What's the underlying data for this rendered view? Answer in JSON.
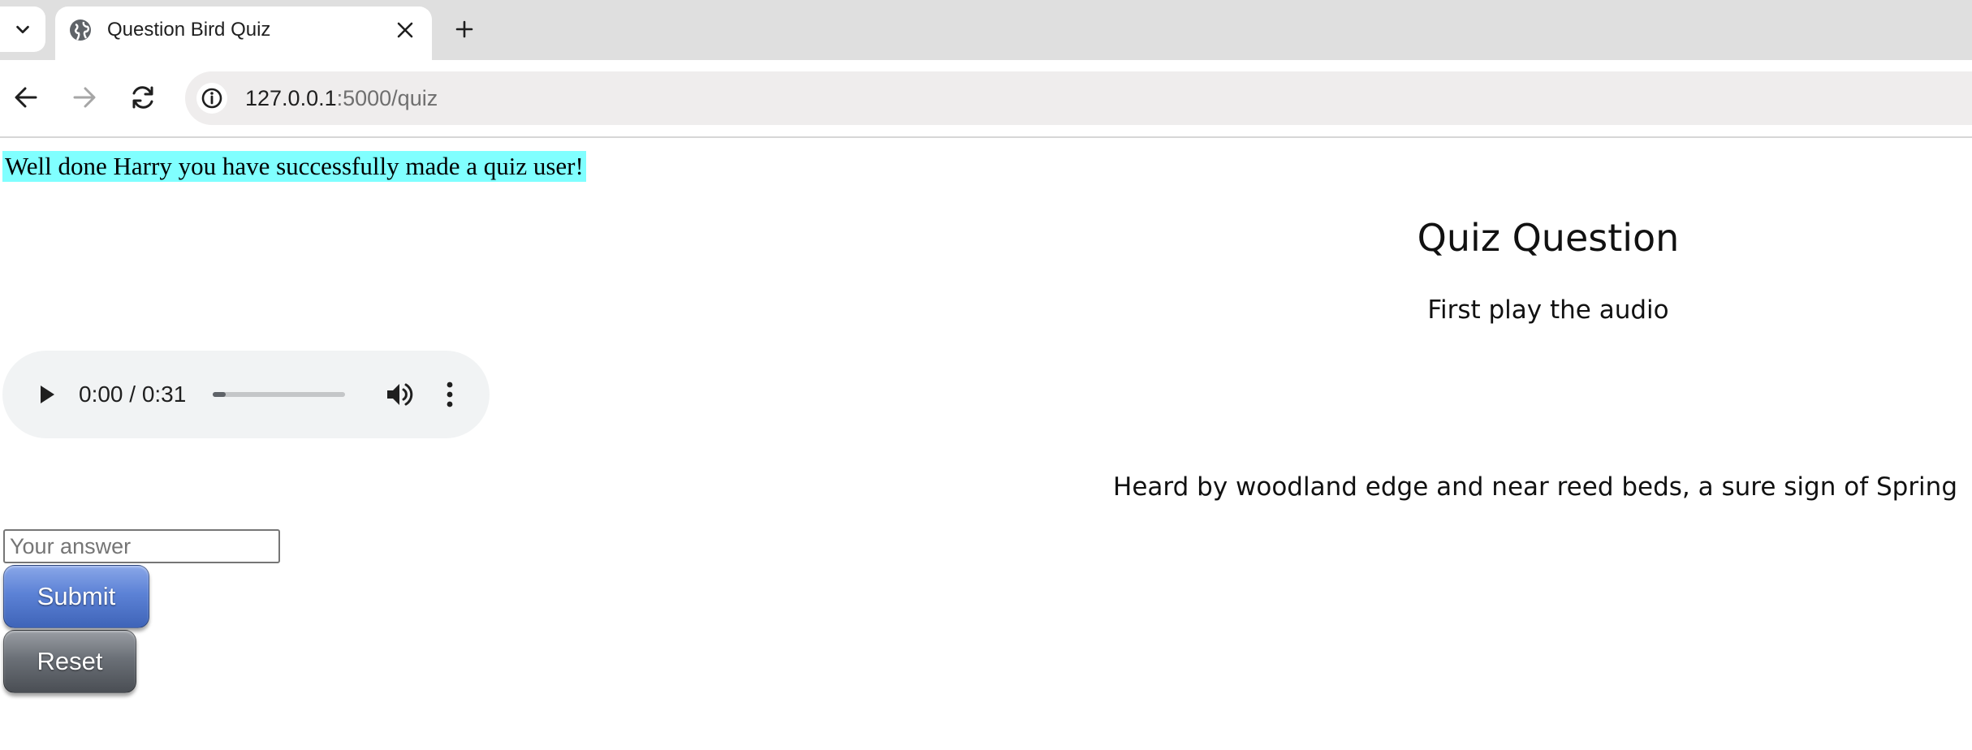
{
  "browser": {
    "tab": {
      "title": "Question Bird Quiz",
      "favicon": "globe-icon"
    },
    "address_bar": {
      "host": "127.0.0.1",
      "path": ":5000/quiz"
    },
    "icons": {
      "tab_menu": "chevron-down-icon",
      "tab_close": "close-icon",
      "new_tab": "plus-icon",
      "back": "arrow-left-icon",
      "forward": "arrow-right-icon",
      "reload": "reload-icon",
      "site_info": "info-icon"
    }
  },
  "page": {
    "flash_message": "Well done Harry you have successfully made a quiz user!",
    "flash_color": "#80ffff",
    "heading": "Quiz Question",
    "instruction": "First play the audio",
    "audio": {
      "time": "0:00 / 0:31",
      "progress": 0.1
    },
    "clue": "Heard by woodland edge and near reed beds, a sure sign of Spring",
    "answer": {
      "placeholder": "Your answer",
      "value": ""
    },
    "buttons": {
      "submit": "Submit",
      "reset": "Reset"
    },
    "colors": {
      "submit": "#5c82d6",
      "reset": "#6b7077"
    }
  }
}
